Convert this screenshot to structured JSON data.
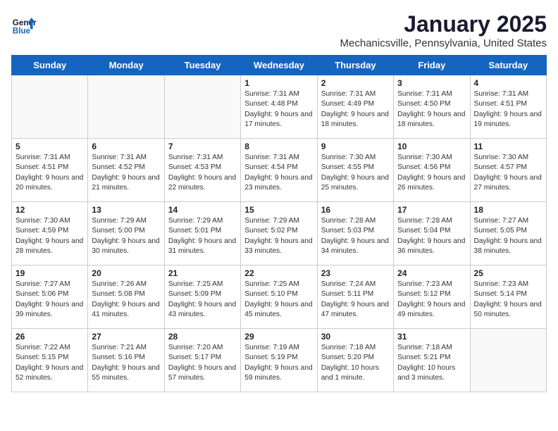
{
  "header": {
    "logo_line1": "General",
    "logo_line2": "Blue",
    "month": "January 2025",
    "location": "Mechanicsville, Pennsylvania, United States"
  },
  "weekdays": [
    "Sunday",
    "Monday",
    "Tuesday",
    "Wednesday",
    "Thursday",
    "Friday",
    "Saturday"
  ],
  "weeks": [
    [
      {
        "day": "",
        "info": ""
      },
      {
        "day": "",
        "info": ""
      },
      {
        "day": "",
        "info": ""
      },
      {
        "day": "1",
        "info": "Sunrise: 7:31 AM\nSunset: 4:48 PM\nDaylight: 9 hours and 17 minutes."
      },
      {
        "day": "2",
        "info": "Sunrise: 7:31 AM\nSunset: 4:49 PM\nDaylight: 9 hours and 18 minutes."
      },
      {
        "day": "3",
        "info": "Sunrise: 7:31 AM\nSunset: 4:50 PM\nDaylight: 9 hours and 18 minutes."
      },
      {
        "day": "4",
        "info": "Sunrise: 7:31 AM\nSunset: 4:51 PM\nDaylight: 9 hours and 19 minutes."
      }
    ],
    [
      {
        "day": "5",
        "info": "Sunrise: 7:31 AM\nSunset: 4:51 PM\nDaylight: 9 hours and 20 minutes."
      },
      {
        "day": "6",
        "info": "Sunrise: 7:31 AM\nSunset: 4:52 PM\nDaylight: 9 hours and 21 minutes."
      },
      {
        "day": "7",
        "info": "Sunrise: 7:31 AM\nSunset: 4:53 PM\nDaylight: 9 hours and 22 minutes."
      },
      {
        "day": "8",
        "info": "Sunrise: 7:31 AM\nSunset: 4:54 PM\nDaylight: 9 hours and 23 minutes."
      },
      {
        "day": "9",
        "info": "Sunrise: 7:30 AM\nSunset: 4:55 PM\nDaylight: 9 hours and 25 minutes."
      },
      {
        "day": "10",
        "info": "Sunrise: 7:30 AM\nSunset: 4:56 PM\nDaylight: 9 hours and 26 minutes."
      },
      {
        "day": "11",
        "info": "Sunrise: 7:30 AM\nSunset: 4:57 PM\nDaylight: 9 hours and 27 minutes."
      }
    ],
    [
      {
        "day": "12",
        "info": "Sunrise: 7:30 AM\nSunset: 4:59 PM\nDaylight: 9 hours and 28 minutes."
      },
      {
        "day": "13",
        "info": "Sunrise: 7:29 AM\nSunset: 5:00 PM\nDaylight: 9 hours and 30 minutes."
      },
      {
        "day": "14",
        "info": "Sunrise: 7:29 AM\nSunset: 5:01 PM\nDaylight: 9 hours and 31 minutes."
      },
      {
        "day": "15",
        "info": "Sunrise: 7:29 AM\nSunset: 5:02 PM\nDaylight: 9 hours and 33 minutes."
      },
      {
        "day": "16",
        "info": "Sunrise: 7:28 AM\nSunset: 5:03 PM\nDaylight: 9 hours and 34 minutes."
      },
      {
        "day": "17",
        "info": "Sunrise: 7:28 AM\nSunset: 5:04 PM\nDaylight: 9 hours and 36 minutes."
      },
      {
        "day": "18",
        "info": "Sunrise: 7:27 AM\nSunset: 5:05 PM\nDaylight: 9 hours and 38 minutes."
      }
    ],
    [
      {
        "day": "19",
        "info": "Sunrise: 7:27 AM\nSunset: 5:06 PM\nDaylight: 9 hours and 39 minutes."
      },
      {
        "day": "20",
        "info": "Sunrise: 7:26 AM\nSunset: 5:08 PM\nDaylight: 9 hours and 41 minutes."
      },
      {
        "day": "21",
        "info": "Sunrise: 7:25 AM\nSunset: 5:09 PM\nDaylight: 9 hours and 43 minutes."
      },
      {
        "day": "22",
        "info": "Sunrise: 7:25 AM\nSunset: 5:10 PM\nDaylight: 9 hours and 45 minutes."
      },
      {
        "day": "23",
        "info": "Sunrise: 7:24 AM\nSunset: 5:11 PM\nDaylight: 9 hours and 47 minutes."
      },
      {
        "day": "24",
        "info": "Sunrise: 7:23 AM\nSunset: 5:12 PM\nDaylight: 9 hours and 49 minutes."
      },
      {
        "day": "25",
        "info": "Sunrise: 7:23 AM\nSunset: 5:14 PM\nDaylight: 9 hours and 50 minutes."
      }
    ],
    [
      {
        "day": "26",
        "info": "Sunrise: 7:22 AM\nSunset: 5:15 PM\nDaylight: 9 hours and 52 minutes."
      },
      {
        "day": "27",
        "info": "Sunrise: 7:21 AM\nSunset: 5:16 PM\nDaylight: 9 hours and 55 minutes."
      },
      {
        "day": "28",
        "info": "Sunrise: 7:20 AM\nSunset: 5:17 PM\nDaylight: 9 hours and 57 minutes."
      },
      {
        "day": "29",
        "info": "Sunrise: 7:19 AM\nSunset: 5:19 PM\nDaylight: 9 hours and 59 minutes."
      },
      {
        "day": "30",
        "info": "Sunrise: 7:18 AM\nSunset: 5:20 PM\nDaylight: 10 hours and 1 minute."
      },
      {
        "day": "31",
        "info": "Sunrise: 7:18 AM\nSunset: 5:21 PM\nDaylight: 10 hours and 3 minutes."
      },
      {
        "day": "",
        "info": ""
      }
    ]
  ]
}
